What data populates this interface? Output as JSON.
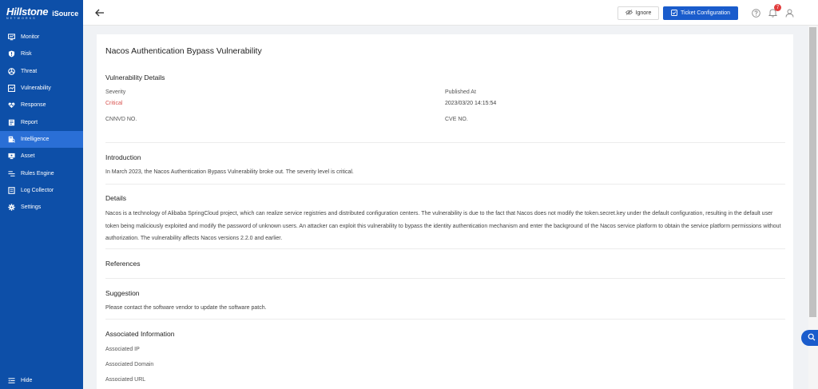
{
  "sidebar": {
    "logo": {
      "brand": "Hillstone",
      "sub": "NETWORKS",
      "product": "iSource"
    },
    "items": [
      {
        "label": "Monitor",
        "icon": "monitor-icon"
      },
      {
        "label": "Risk",
        "icon": "shield-icon"
      },
      {
        "label": "Threat",
        "icon": "biohazard-icon"
      },
      {
        "label": "Vulnerability",
        "icon": "vulnerability-icon"
      },
      {
        "label": "Response",
        "icon": "response-icon"
      },
      {
        "label": "Report",
        "icon": "report-icon"
      },
      {
        "label": "Intelligence",
        "icon": "intelligence-icon",
        "active": true
      },
      {
        "label": "Asset",
        "icon": "asset-icon"
      },
      {
        "label": "Rules Engine",
        "icon": "rules-icon"
      },
      {
        "label": "Log Collector",
        "icon": "log-icon"
      },
      {
        "label": "Settings",
        "icon": "gear-icon"
      }
    ],
    "hide_label": "Hide"
  },
  "header": {
    "ignore_label": "Ignore",
    "ticket_label": "Ticket Configuration",
    "notification_count": "7"
  },
  "detail": {
    "title": "Nacos Authentication Bypass Vulnerability",
    "vuln_details": {
      "heading": "Vulnerability Details",
      "severity_label": "Severity",
      "severity_value": "Critical",
      "published_label": "Published At",
      "published_value": "2023/03/20 14:15:54",
      "cnnvd_label": "CNNVD NO.",
      "cve_label": "CVE NO."
    },
    "introduction": {
      "heading": "Introduction",
      "text": "In March 2023, the Nacos Authentication Bypass Vulnerability broke out. The severity level is critical."
    },
    "details": {
      "heading": "Details",
      "text": "Nacos is a technology of Alibaba SpringCloud project, which can realize service registries and distributed configuration centers. The vulnerability is due to the fact that Nacos does not modify the token.secret.key under the default configuration, resulting in the default user token being maliciously exploited and modify the password of unknown users. An attacker can exploit this vulnerability to bypass the identity authentication mechanism and enter the background of the Nacos service platform to obtain the service platform permissions without authorization. The vulnerability affects Nacos versions 2.2.0 and earlier."
    },
    "references": {
      "heading": "References"
    },
    "suggestion": {
      "heading": "Suggestion",
      "text": "Please contact the software vendor to update the software patch."
    },
    "associated": {
      "heading": "Associated Information",
      "ip_label": "Associated IP",
      "domain_label": "Associated Domain",
      "url_label": "Associated URL"
    }
  },
  "colors": {
    "sidebar_bg": "#0d4fa8",
    "sidebar_active": "#2a6fd6",
    "primary": "#1a5ccc",
    "critical": "#d9534f",
    "badge": "#e23d3d"
  }
}
